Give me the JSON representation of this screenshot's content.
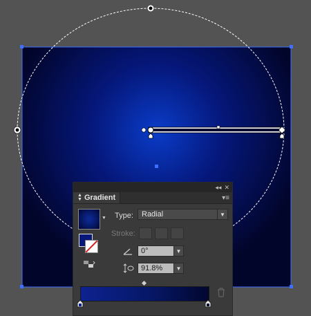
{
  "colors": {
    "canvas_bg": "#535353",
    "artboard_center": "#0a3cc8",
    "artboard_edge": "#02052a",
    "selection_blue": "#3f6fff",
    "gradient_start": "#0d2290",
    "gradient_end": "#02072e"
  },
  "icons": {
    "collapse": "collapse-panel-icon",
    "close": "close-panel-icon",
    "panel_menu": "panel-menu-icon",
    "tab_arrows": "tab-updown-arrows-icon",
    "angle": "angle-icon",
    "aspect_ratio": "aspect-ratio-icon",
    "reverse": "reverse-gradient-icon",
    "delete": "trash-icon"
  },
  "panel": {
    "tab_label": "Gradient",
    "collapse_glyph": "◂◂",
    "close_glyph": "✕",
    "menu_glyph": "▾≡",
    "type_label": "Type:",
    "type_value": "Radial",
    "stroke_label": "Stroke:",
    "angle_value": "0°",
    "aspect_value": "91.8%",
    "gradient_slider": {
      "stops": [
        0,
        100
      ],
      "midpoint_percent": 50
    }
  }
}
